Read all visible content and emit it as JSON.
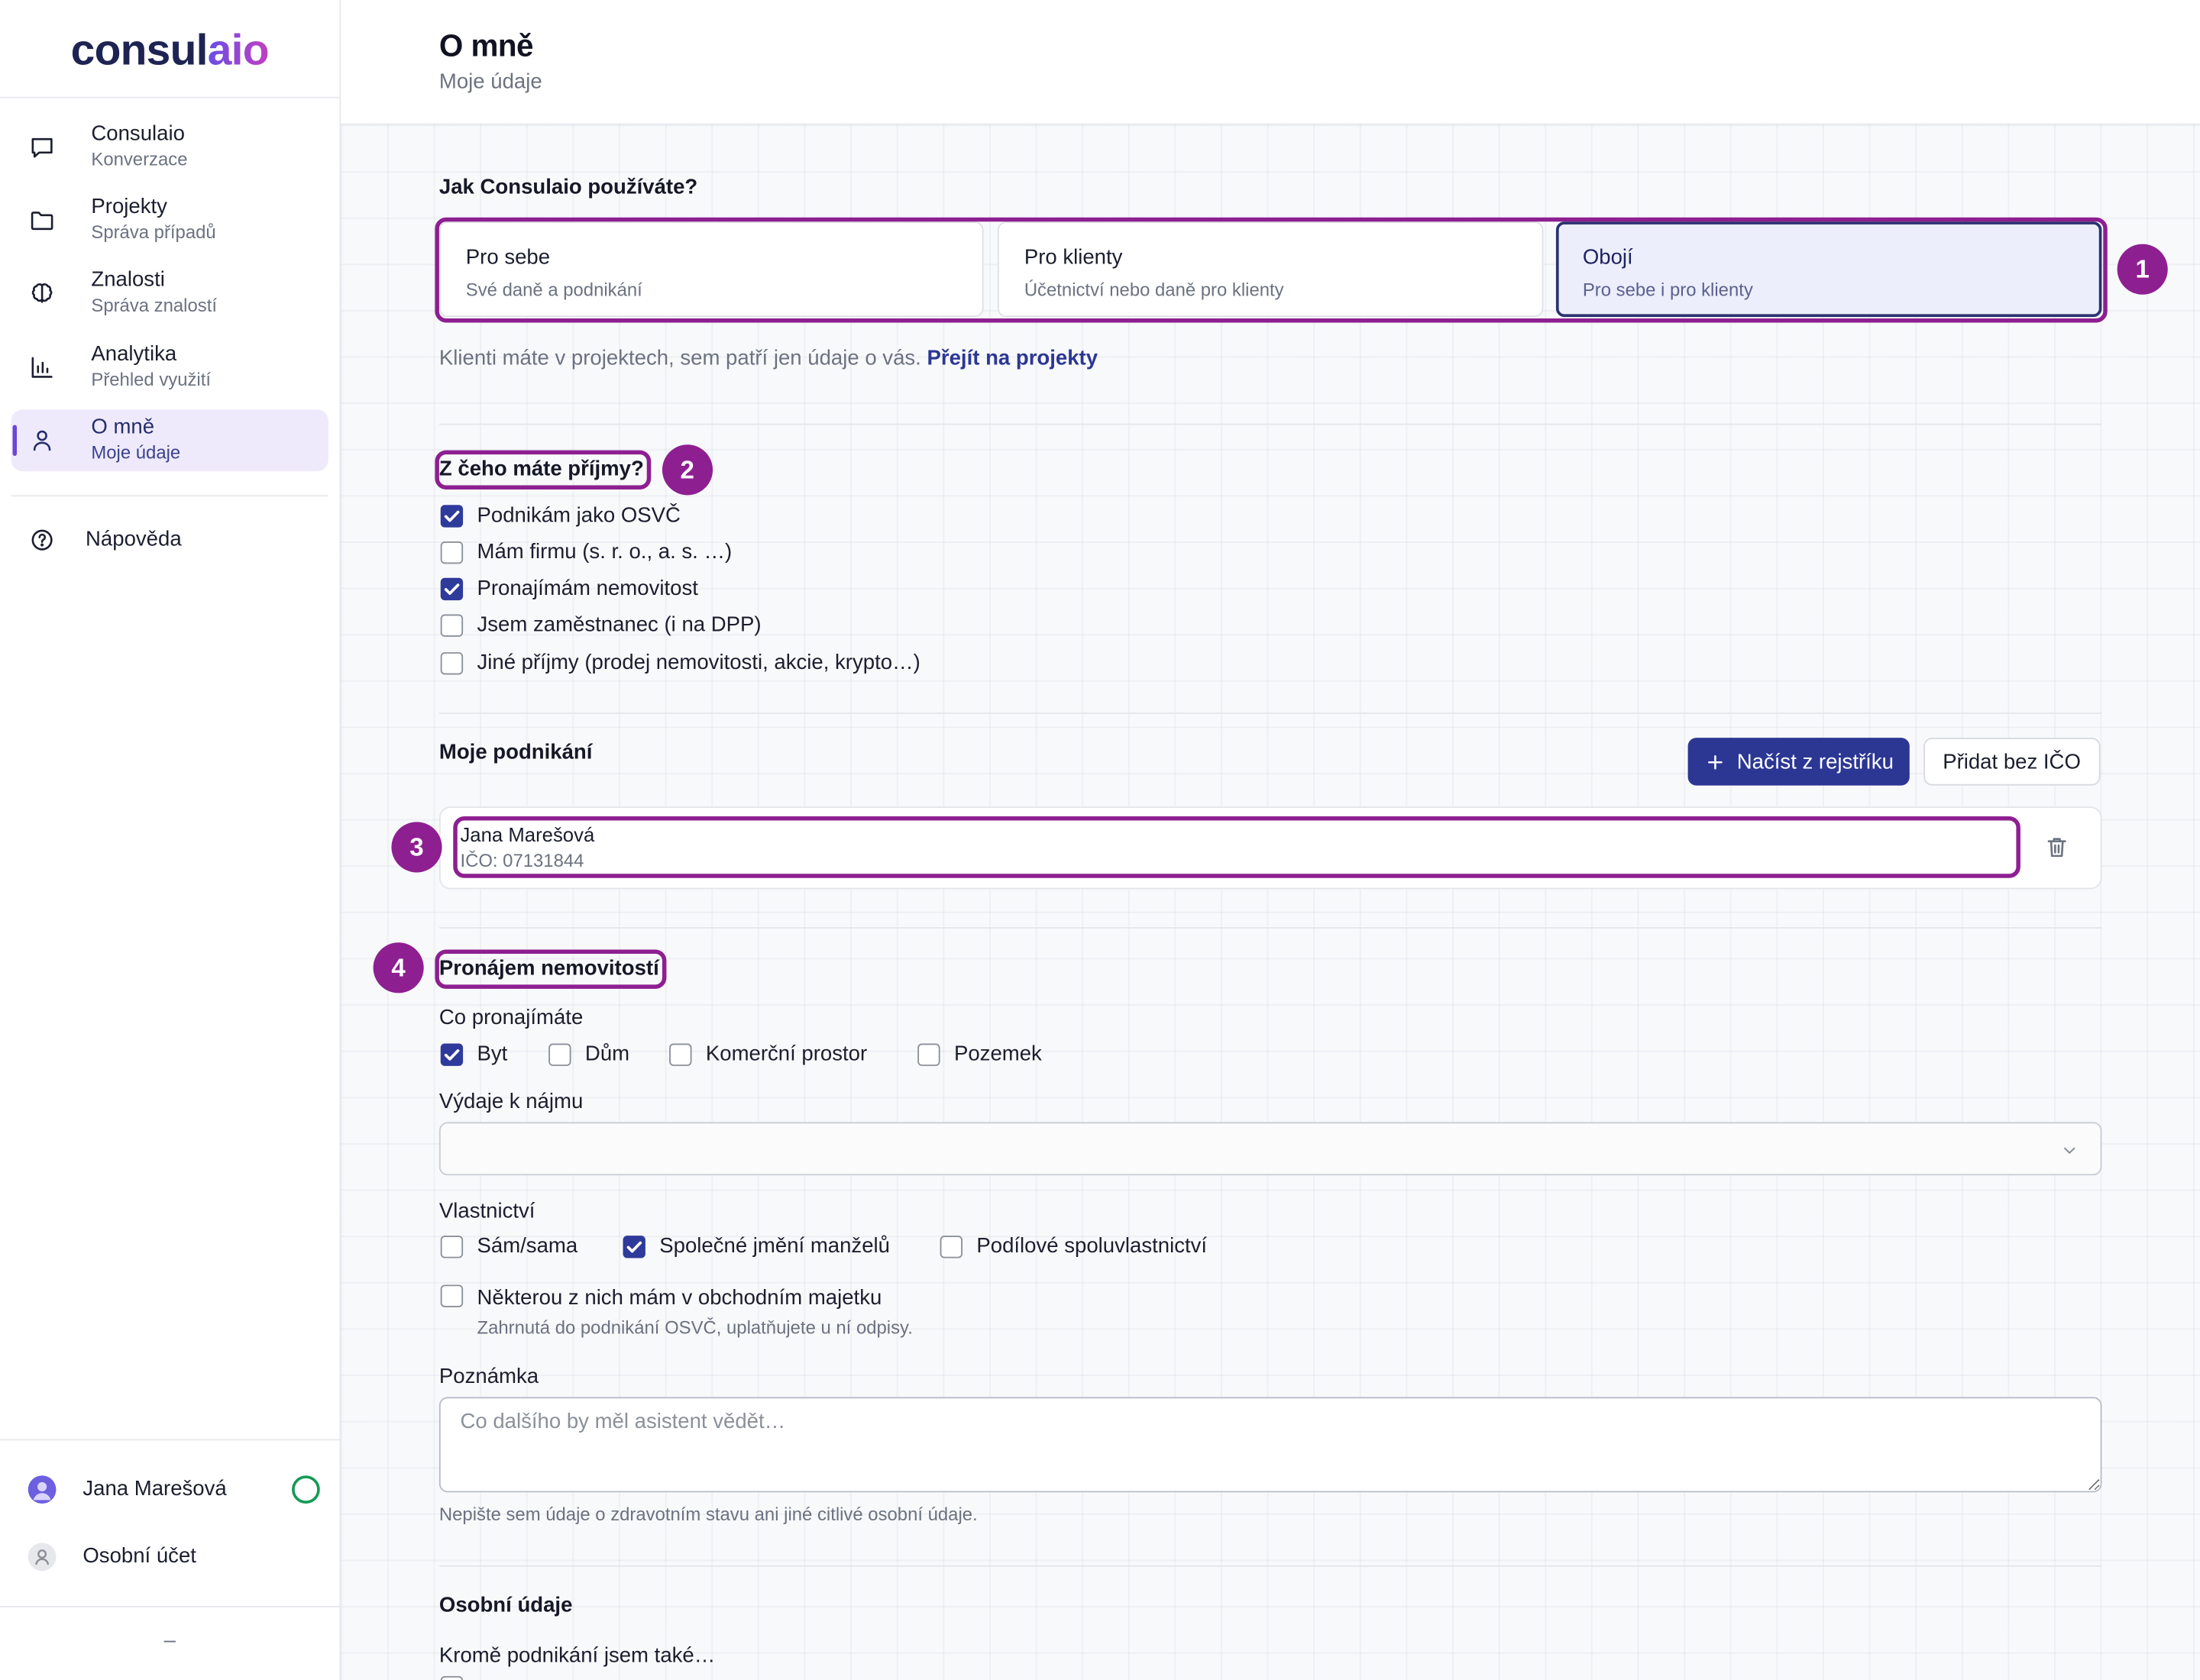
{
  "app": {
    "logo_main": "consul",
    "logo_accent": "aio"
  },
  "colors": {
    "primary": "#2c3794",
    "annotation": "#8e1f91",
    "active_bg": "#efeafb",
    "active_accent": "#6b45d6",
    "status": "#169a57"
  },
  "sidebar": {
    "items": [
      {
        "title": "Consulaio",
        "subtitle": "Konverzace",
        "icon": "chat-icon",
        "active": false
      },
      {
        "title": "Projekty",
        "subtitle": "Správa případů",
        "icon": "folder-icon",
        "active": false
      },
      {
        "title": "Znalosti",
        "subtitle": "Správa znalostí",
        "icon": "brain-icon",
        "active": false
      },
      {
        "title": "Analytika",
        "subtitle": "Přehled využití",
        "icon": "bar-chart-icon",
        "active": false
      },
      {
        "title": "O mně",
        "subtitle": "Moje údaje",
        "icon": "user-icon",
        "active": true
      }
    ],
    "help": {
      "label": "Nápověda",
      "icon": "help-circle-icon"
    },
    "user": {
      "name": "Jana Marešová",
      "icon": "avatar-icon",
      "status_icon": "status-ring-icon"
    },
    "account": {
      "label": "Osobní účet",
      "icon": "account-icon"
    },
    "collapse_label": "–"
  },
  "header": {
    "title": "O mně",
    "subtitle": "Moje údaje"
  },
  "usage": {
    "question": "Jak Consulaio používáte?",
    "options": [
      {
        "title": "Pro sebe",
        "subtitle": "Své daně a podnikání",
        "selected": false
      },
      {
        "title": "Pro klienty",
        "subtitle": "Účetnictví nebo daně pro klienty",
        "selected": false
      },
      {
        "title": "Obojí",
        "subtitle": "Pro sebe i pro klienty",
        "selected": true
      }
    ],
    "note": "Klienti máte v projektech, sem patří jen údaje o vás.",
    "link": "Přejít na projekty"
  },
  "income": {
    "title": "Z čeho máte příjmy?",
    "options": [
      {
        "label": "Podnikám jako OSVČ",
        "checked": true
      },
      {
        "label": "Mám firmu (s. r. o., a. s. …)",
        "checked": false
      },
      {
        "label": "Pronajímám nemovitost",
        "checked": true
      },
      {
        "label": "Jsem zaměstnanec (i na DPP)",
        "checked": false
      },
      {
        "label": "Jiné příjmy (prodej nemovitosti, akcie, krypto…)",
        "checked": false
      }
    ]
  },
  "business": {
    "title": "Moje podnikání",
    "load_button": "Načíst z rejstříku",
    "add_button": "Přidat bez IČO",
    "entries": [
      {
        "name": "Jana Marešová",
        "ico": "IČO: 07131844"
      }
    ]
  },
  "rental": {
    "title": "Pronájem nemovitostí",
    "what_label": "Co pronajímáte",
    "what_options": [
      {
        "label": "Byt",
        "checked": true
      },
      {
        "label": "Dům",
        "checked": false
      },
      {
        "label": "Komerční prostor",
        "checked": false
      },
      {
        "label": "Pozemek",
        "checked": false
      }
    ],
    "expenses_label": "Výdaje k nájmu",
    "expenses_value": "",
    "ownership_label": "Vlastnictví",
    "ownership_options": [
      {
        "label": "Sám/sama",
        "checked": false
      },
      {
        "label": "Společné jmění manželů",
        "checked": true
      },
      {
        "label": "Podílové spoluvlastnictví",
        "checked": false
      }
    ],
    "business_asset": {
      "label": "Některou z nich mám v obchodním majetku",
      "hint": "Zahrnutá do podnikání OSVČ, uplatňujete u ní odpisy.",
      "checked": false
    },
    "note_label": "Poznámka",
    "note_placeholder": "Co dalšího by měl asistent vědět…",
    "note_hint": "Nepište sem údaje o zdravotním stavu ani jiné citlivé osobní údaje."
  },
  "personal": {
    "title": "Osobní údaje",
    "also_label": "Kromě podnikání jsem také…"
  },
  "annotations": {
    "badges": [
      "1",
      "2",
      "3",
      "4"
    ]
  }
}
